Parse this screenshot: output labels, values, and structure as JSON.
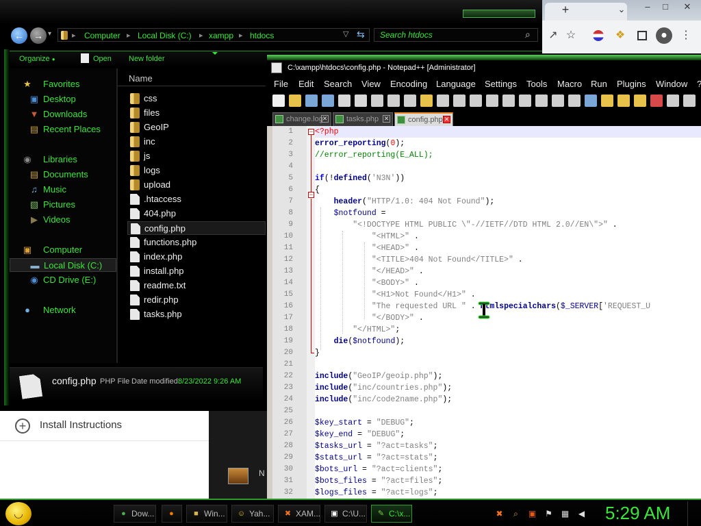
{
  "browser": {
    "window_controls": [
      "–",
      "□",
      "✕"
    ],
    "new_tab": "+",
    "tab_dropdown": "⌄",
    "toolbar_icons": [
      "share-icon",
      "star-icon",
      "profile-flag-icon",
      "extension-icon",
      "sidebar-icon",
      "account-icon",
      "menu-icon"
    ],
    "page_item": "Install Instructions",
    "mid_letter": "N"
  },
  "explorer": {
    "breadcrumbs": [
      "Computer",
      "Local Disk (C:)",
      "xampp",
      "htdocs"
    ],
    "search_placeholder": "Search htdocs",
    "commands": {
      "organize": "Organize",
      "open": "Open",
      "new_folder": "New folder"
    },
    "nav": [
      {
        "label": "Favorites",
        "icon": "star-icon",
        "sub": false,
        "sel": false
      },
      {
        "label": "Desktop",
        "icon": "desktop-icon",
        "sub": true,
        "sel": false
      },
      {
        "label": "Downloads",
        "icon": "downloads-icon",
        "sub": true,
        "sel": false
      },
      {
        "label": "Recent Places",
        "icon": "recent-places-icon",
        "sub": true,
        "sel": false
      },
      {
        "label": "Libraries",
        "icon": "libraries-icon",
        "sub": false,
        "sel": false
      },
      {
        "label": "Documents",
        "icon": "documents-icon",
        "sub": true,
        "sel": false
      },
      {
        "label": "Music",
        "icon": "music-icon",
        "sub": true,
        "sel": false
      },
      {
        "label": "Pictures",
        "icon": "pictures-icon",
        "sub": true,
        "sel": false
      },
      {
        "label": "Videos",
        "icon": "videos-icon",
        "sub": true,
        "sel": false
      },
      {
        "label": "Computer",
        "icon": "computer-icon",
        "sub": false,
        "sel": false
      },
      {
        "label": "Local Disk (C:)",
        "icon": "drive-icon",
        "sub": true,
        "sel": true
      },
      {
        "label": "CD Drive (E:)",
        "icon": "cd-drive-icon",
        "sub": true,
        "sel": false
      },
      {
        "label": "Network",
        "icon": "network-icon",
        "sub": false,
        "sel": false
      }
    ],
    "column_name": "Name",
    "files": [
      {
        "name": "css",
        "kind": "folder"
      },
      {
        "name": "files",
        "kind": "folder"
      },
      {
        "name": "GeoIP",
        "kind": "folder"
      },
      {
        "name": "inc",
        "kind": "folder"
      },
      {
        "name": "js",
        "kind": "folder"
      },
      {
        "name": "logs",
        "kind": "folder"
      },
      {
        "name": "upload",
        "kind": "folder"
      },
      {
        "name": ".htaccess",
        "kind": "file"
      },
      {
        "name": "404.php",
        "kind": "file"
      },
      {
        "name": "config.php",
        "kind": "file",
        "selected": true
      },
      {
        "name": "functions.php",
        "kind": "file"
      },
      {
        "name": "index.php",
        "kind": "file"
      },
      {
        "name": "install.php",
        "kind": "file"
      },
      {
        "name": "readme.txt",
        "kind": "file"
      },
      {
        "name": "redir.php",
        "kind": "file"
      },
      {
        "name": "tasks.php",
        "kind": "file"
      }
    ],
    "details": {
      "name": "config.php",
      "type": "PHP File",
      "date_label": "Date modified:",
      "date": "8/23/2022 9:26 AM"
    }
  },
  "notepad": {
    "title": "C:\\xampp\\htdocs\\config.php - Notepad++ [Administrator]",
    "menus": [
      "File",
      "Edit",
      "Search",
      "View",
      "Encoding",
      "Language",
      "Settings",
      "Tools",
      "Macro",
      "Run",
      "Plugins",
      "Window",
      "?"
    ],
    "tabs": [
      {
        "label": "change.log",
        "active": false
      },
      {
        "label": "tasks.php",
        "active": false
      },
      {
        "label": "config.php",
        "active": true
      }
    ],
    "tab_close": "✕",
    "fold_open": "−",
    "line_numbers": [
      "1",
      "2",
      "3",
      "4",
      "5",
      "6",
      "7",
      "8",
      "9",
      "10",
      "11",
      "12",
      "13",
      "14",
      "15",
      "16",
      "17",
      "18",
      "19",
      "20",
      "21",
      "22",
      "23",
      "24",
      "25",
      "26",
      "27",
      "28",
      "29",
      "30",
      "31",
      "32"
    ]
  },
  "taskbar": {
    "start_face": "◡",
    "buttons": [
      {
        "label": "Dow...",
        "icon": "chrome-icon",
        "color": "#4caf50",
        "glyph": "●",
        "active": false,
        "icon_only": false
      },
      {
        "label": "",
        "icon": "firefox-icon",
        "color": "#ff7a00",
        "glyph": "●",
        "active": false,
        "icon_only": true
      },
      {
        "label": "Win...",
        "icon": "explorer-icon",
        "color": "#d9b54a",
        "glyph": "■",
        "active": false,
        "icon_only": false
      },
      {
        "label": "Yah...",
        "icon": "yahoo-messenger-icon",
        "color": "#e8c400",
        "glyph": "☺",
        "active": false,
        "icon_only": false
      },
      {
        "label": "XAM...",
        "icon": "xampp-icon",
        "color": "#f47321",
        "glyph": "✖",
        "active": false,
        "icon_only": false
      },
      {
        "label": "C:\\U...",
        "icon": "cmd-icon",
        "color": "#ffffff",
        "glyph": "▣",
        "active": false,
        "icon_only": false
      },
      {
        "label": "C:\\x...",
        "icon": "notepadpp-icon",
        "color": "#7ccf4a",
        "glyph": "✎",
        "active": true,
        "icon_only": false
      }
    ],
    "tray_icons": [
      {
        "name": "xampp-tray-icon",
        "glyph": "✖",
        "color": "#f47321"
      },
      {
        "name": "search-tray-icon",
        "glyph": "⌕",
        "color": "#f0a030"
      },
      {
        "name": "security-tray-icon",
        "glyph": "▣",
        "color": "#e05a1a"
      },
      {
        "name": "action-center-icon",
        "glyph": "⚑",
        "color": "#ddd"
      },
      {
        "name": "network-tray-icon",
        "glyph": "▦",
        "color": "#ddd"
      },
      {
        "name": "volume-icon",
        "glyph": "◀",
        "color": "#ddd"
      }
    ],
    "clock": "5:29 AM"
  }
}
